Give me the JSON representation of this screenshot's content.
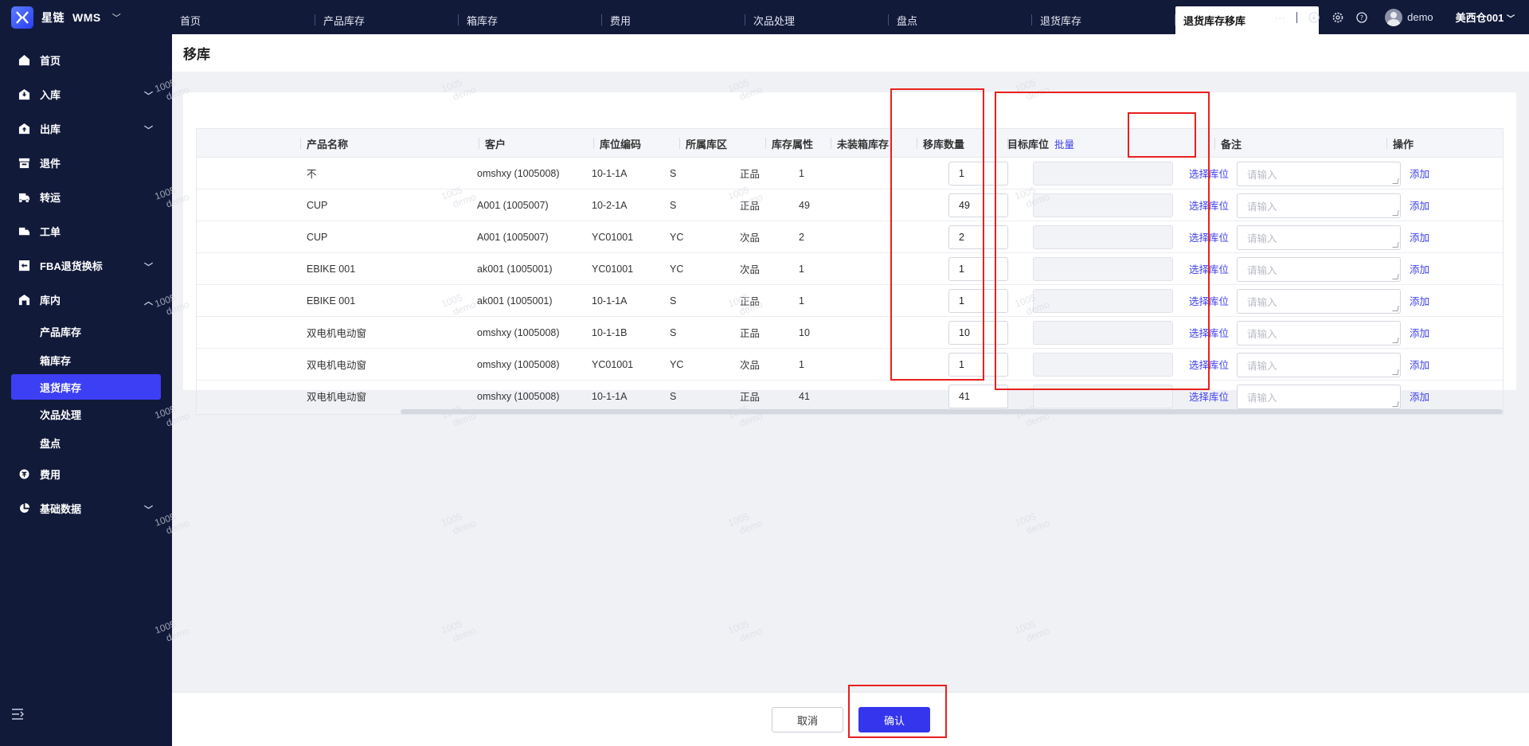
{
  "app": {
    "brand": "星链",
    "product": "WMS"
  },
  "tabs": [
    {
      "label": "首页"
    },
    {
      "label": "产品库存"
    },
    {
      "label": "箱库存"
    },
    {
      "label": "费用"
    },
    {
      "label": "次品处理"
    },
    {
      "label": "盘点"
    },
    {
      "label": "退货库存"
    },
    {
      "label": "退货库存移库",
      "active": true
    }
  ],
  "header": {
    "more": "···",
    "user": "demo",
    "warehouse": "美西仓001"
  },
  "sidebar": {
    "items": [
      {
        "label": "首页",
        "icon": "home-icon"
      },
      {
        "label": "入库",
        "icon": "inbound-icon",
        "expandable": true
      },
      {
        "label": "出库",
        "icon": "outbound-icon",
        "expandable": true
      },
      {
        "label": "退件",
        "icon": "return-icon"
      },
      {
        "label": "转运",
        "icon": "truck-icon"
      },
      {
        "label": "工单",
        "icon": "workorder-icon"
      },
      {
        "label": "FBA退货换标",
        "icon": "fba-icon",
        "expandable": true
      },
      {
        "label": "库内",
        "icon": "warehouse-icon",
        "expanded": true
      }
    ],
    "sub_items": [
      {
        "label": "产品库存"
      },
      {
        "label": "箱库存"
      },
      {
        "label": "退货库存",
        "active": true
      },
      {
        "label": "次品处理"
      },
      {
        "label": "盘点"
      }
    ],
    "items_after": [
      {
        "label": "费用",
        "icon": "fee-icon"
      },
      {
        "label": "基础数据",
        "icon": "chart-pie-icon",
        "expandable": true
      }
    ]
  },
  "page": {
    "title": "移库"
  },
  "table": {
    "columns": {
      "product": "产品名称",
      "customer": "客户",
      "location": "库位编码",
      "zone": "所属库区",
      "attr": "库存属性",
      "stock": "未装箱库存",
      "qty": "移库数量",
      "target": "目标库位",
      "batch": "批量",
      "remark": "备注",
      "action": "操作"
    },
    "select_label": "选择库位",
    "remark_placeholder": "请输入",
    "add_label": "添加",
    "rows": [
      {
        "product": "不",
        "customer": "omshxy (1005008)",
        "location": "10-1-1A",
        "zone": "S",
        "attr": "正品",
        "stock": "1",
        "qty": "1"
      },
      {
        "product": "CUP",
        "customer": "A001 (1005007)",
        "location": "10-2-1A",
        "zone": "S",
        "attr": "正品",
        "stock": "49",
        "qty": "49"
      },
      {
        "product": "CUP",
        "customer": "A001 (1005007)",
        "location": "YC01001",
        "zone": "YC",
        "attr": "次品",
        "stock": "2",
        "qty": "2"
      },
      {
        "product": "EBIKE 001",
        "customer": "ak001 (1005001)",
        "location": "YC01001",
        "zone": "YC",
        "attr": "次品",
        "stock": "1",
        "qty": "1"
      },
      {
        "product": "EBIKE 001",
        "customer": "ak001 (1005001)",
        "location": "10-1-1A",
        "zone": "S",
        "attr": "正品",
        "stock": "1",
        "qty": "1"
      },
      {
        "product": "双电机电动窗",
        "customer": "omshxy (1005008)",
        "location": "10-1-1B",
        "zone": "S",
        "attr": "正品",
        "stock": "10",
        "qty": "10"
      },
      {
        "product": "双电机电动窗",
        "customer": "omshxy (1005008)",
        "location": "YC01001",
        "zone": "YC",
        "attr": "次品",
        "stock": "1",
        "qty": "1"
      },
      {
        "product": "双电机电动窗",
        "customer": "omshxy (1005008)",
        "location": "10-1-1A",
        "zone": "S",
        "attr": "正品",
        "stock": "41",
        "qty": "41"
      }
    ]
  },
  "footer": {
    "cancel": "取消",
    "confirm": "确认"
  },
  "watermark": {
    "line1": "1005",
    "line2": "demo"
  },
  "colors": {
    "nav_bg": "#121a3a",
    "accent": "#3c3ff0",
    "annotation": "#e8201e"
  }
}
